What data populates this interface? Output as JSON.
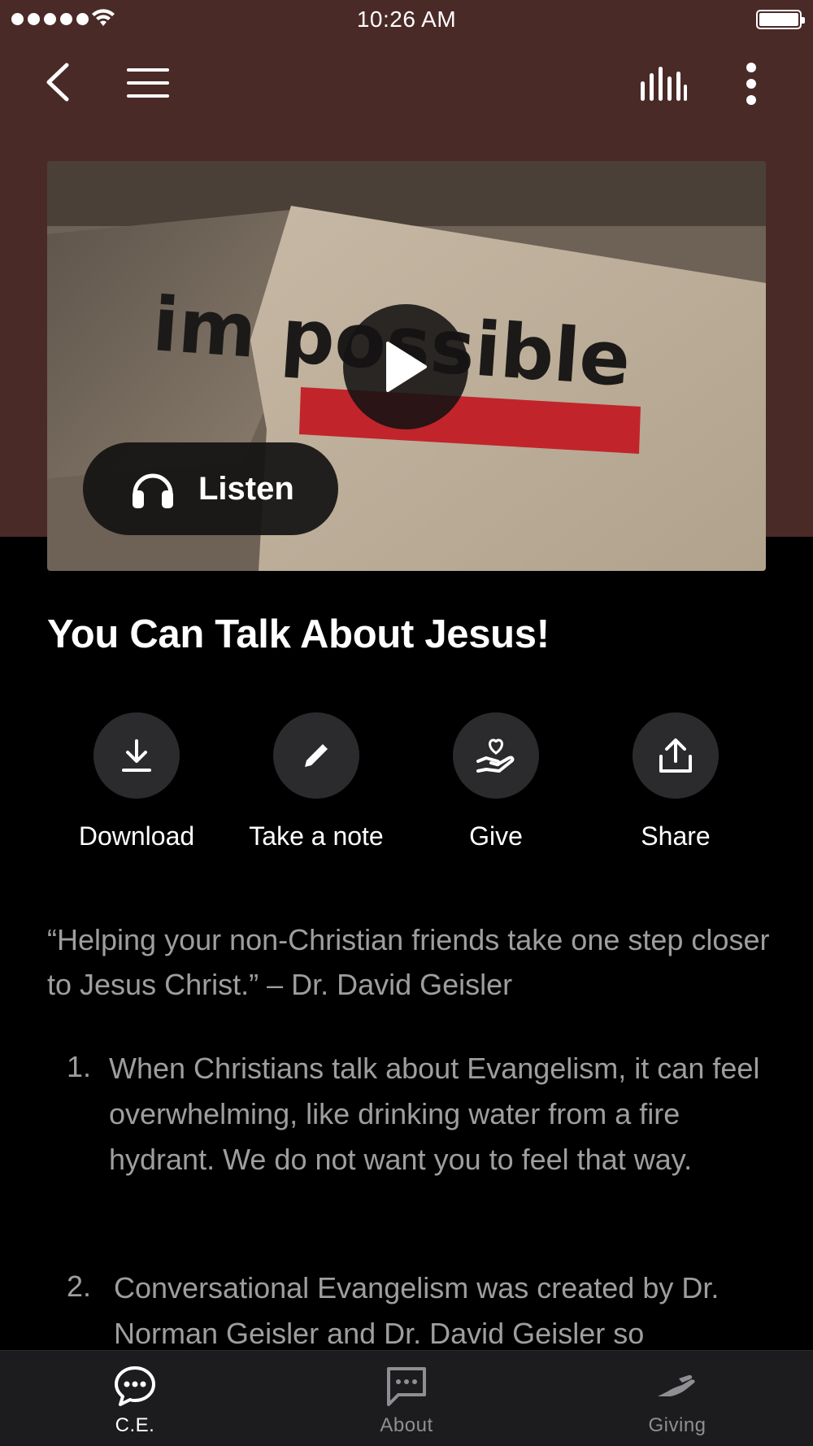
{
  "status_bar": {
    "time": "10:26 AM"
  },
  "episode": {
    "listen_label": "Listen",
    "title": "You Can Talk About Jesus!"
  },
  "actions": [
    {
      "label": "Download",
      "icon": "download-icon"
    },
    {
      "label": "Take a note",
      "icon": "pencil-icon"
    },
    {
      "label": "Give",
      "icon": "give-hand-heart-icon"
    },
    {
      "label": "Share",
      "icon": "share-icon"
    }
  ],
  "description": {
    "quote": "“Helping your non-Christian friends take one step closer to Jesus Christ.” – Dr. David Geisler",
    "items": [
      {
        "number": "1.",
        "text": "When Christians talk about Evangelism, it can feel overwhelming, like drinking water from a fire hydrant. We do not want you to feel that way."
      },
      {
        "number": "2.",
        "text": "Conversational Evangelism was created by Dr. Norman Geisler and Dr. David Geisler so"
      }
    ]
  },
  "tab_bar": {
    "tabs": [
      {
        "label": "C.E.",
        "icon": "chat-bubble-icon",
        "active": true
      },
      {
        "label": "About",
        "icon": "message-square-icon",
        "active": false
      },
      {
        "label": "Giving",
        "icon": "giving-hand-icon",
        "active": false
      }
    ]
  },
  "colors": {
    "header_bg": "#4a2a27",
    "page_bg": "#000000",
    "tab_bar_bg": "#1c1c1e",
    "action_circle_bg": "#2b2b2d",
    "body_text": "#9e9e9e",
    "tab_inactive": "#8e8e93"
  }
}
